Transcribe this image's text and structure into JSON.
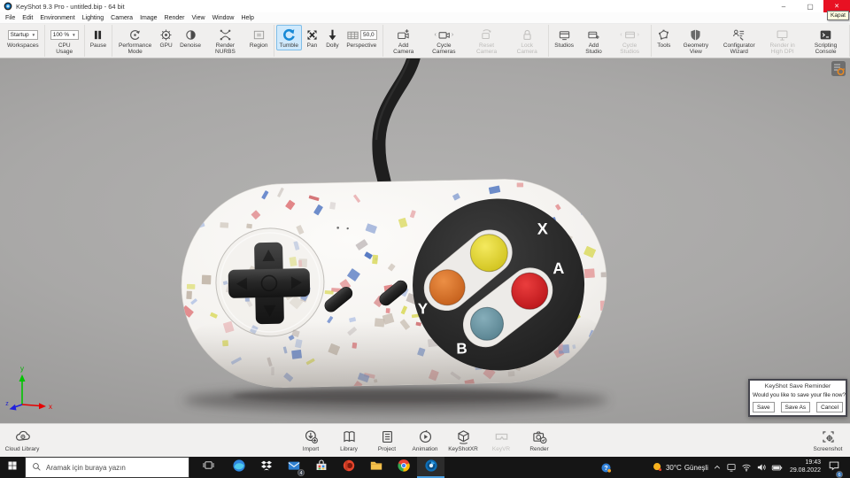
{
  "window": {
    "title": "KeyShot 9.3 Pro  - untitled.bip  - 64 bit",
    "close_tooltip": "Kapat",
    "controls": {
      "minimize": "–",
      "maximize": "▢",
      "close": "✕"
    },
    "close_color": "#e81123"
  },
  "menu": {
    "items": [
      "File",
      "Edit",
      "Environment",
      "Lighting",
      "Camera",
      "Image",
      "Render",
      "View",
      "Window",
      "Help"
    ]
  },
  "toolbar": {
    "highlight_color": "#cfe9fc",
    "groups": [
      {
        "items": [
          {
            "label": "Workspaces",
            "icon": "dropdown-icon",
            "value": "Startup"
          }
        ]
      },
      {
        "items": [
          {
            "label": "CPU Usage",
            "icon": "dropdown-icon",
            "value": "100 %"
          }
        ]
      },
      {
        "items": [
          {
            "label": "Pause",
            "icon": "pause-icon"
          }
        ]
      },
      {
        "items": [
          {
            "label": "Performance Mode",
            "icon": "performance-icon"
          },
          {
            "label": "GPU",
            "icon": "gpu-icon"
          },
          {
            "label": "Denoise",
            "icon": "denoise-icon"
          },
          {
            "label": "Render NURBS",
            "icon": "nurbs-icon"
          },
          {
            "label": "Region",
            "icon": "region-icon"
          }
        ]
      },
      {
        "items": [
          {
            "label": "Tumble",
            "icon": "tumble-icon",
            "state": "active"
          },
          {
            "label": "Pan",
            "icon": "pan-icon"
          },
          {
            "label": "Dolly",
            "icon": "dolly-icon"
          },
          {
            "label": "Perspective",
            "icon": "perspective-icon",
            "value": "50,0"
          }
        ]
      },
      {
        "items": [
          {
            "label": "Add Camera",
            "icon": "add-camera-icon"
          },
          {
            "label": "Cycle Cameras",
            "icon": "cycle-cameras-icon",
            "arrows": true
          },
          {
            "label": "Reset Camera",
            "icon": "reset-camera-icon",
            "state": "disabled"
          },
          {
            "label": "Lock Camera",
            "icon": "lock-camera-icon",
            "state": "disabled"
          }
        ]
      },
      {
        "items": [
          {
            "label": "Studios",
            "icon": "studios-icon"
          },
          {
            "label": "Add Studio",
            "icon": "add-studio-icon"
          },
          {
            "label": "Cycle Studios",
            "icon": "cycle-studios-icon",
            "state": "disabled",
            "arrows": true
          }
        ]
      },
      {
        "items": [
          {
            "label": "Tools",
            "icon": "tools-icon"
          },
          {
            "label": "Geometry View",
            "icon": "geometry-icon"
          },
          {
            "label": "Configurator Wizard",
            "icon": "configurator-icon"
          },
          {
            "label": "Render in High DPI",
            "icon": "highdpi-icon",
            "state": "disabled"
          },
          {
            "label": "Scripting Console",
            "icon": "scripting-icon"
          }
        ]
      }
    ]
  },
  "scene": {
    "gamepad": {
      "letters": {
        "top": "X",
        "right": "A",
        "left": "Y",
        "bottom": "B"
      },
      "button_colors": {
        "top": "#e3d33c",
        "left": "#e2762f",
        "right": "#d81f26",
        "bottom": "#6d9fae"
      },
      "body_color": "#f6f4f1",
      "dark_color": "#262626",
      "confetti_colors": [
        "#dd6f72",
        "#c94d52",
        "#e4989b",
        "#5d7fc9",
        "#8fa9dd",
        "#4f74c0",
        "#b4a9a4",
        "#c3b8ab",
        "#c9c2c2",
        "#d9d855"
      ]
    },
    "axis": {
      "x": "x",
      "y": "y",
      "z": "z"
    }
  },
  "dialog": {
    "title": "KeyShot Save Reminder",
    "message": "Would you like to save your file now?",
    "buttons": [
      "Save",
      "Save As",
      "Cancel"
    ]
  },
  "ribbon": {
    "left": [
      {
        "label": "Cloud Library",
        "icon": "cloud-library-icon"
      }
    ],
    "center": [
      {
        "label": "Import",
        "icon": "import-icon"
      },
      {
        "label": "Library",
        "icon": "library-icon"
      },
      {
        "label": "Project",
        "icon": "project-icon"
      },
      {
        "label": "Animation",
        "icon": "animation-icon"
      },
      {
        "label": "KeyShotXR",
        "icon": "keyshotxr-icon"
      },
      {
        "label": "KeyVR",
        "icon": "keyvr-icon",
        "state": "disabled"
      },
      {
        "label": "Render",
        "icon": "render-icon"
      }
    ],
    "right": [
      {
        "label": "Screenshot",
        "icon": "screenshot-icon"
      }
    ]
  },
  "taskbar": {
    "search_placeholder": "Aramak için buraya yazın",
    "apps": [
      {
        "name": "edge",
        "icon": "edge-icon"
      },
      {
        "name": "dropbox",
        "icon": "dropbox-icon"
      },
      {
        "name": "mail",
        "icon": "mail-icon",
        "badge": "4"
      },
      {
        "name": "store",
        "icon": "store-icon"
      },
      {
        "name": "office",
        "icon": "office-icon"
      },
      {
        "name": "explorer",
        "icon": "explorer-icon"
      },
      {
        "name": "chrome",
        "icon": "chrome-icon"
      },
      {
        "name": "keyshot",
        "icon": "keyshot-icon",
        "active": true
      }
    ],
    "weather": {
      "temp": "30°C",
      "condition": "Güneşli"
    },
    "clock": {
      "time": "19:43",
      "date": "29.08.2022"
    },
    "notification_badge": "6"
  }
}
